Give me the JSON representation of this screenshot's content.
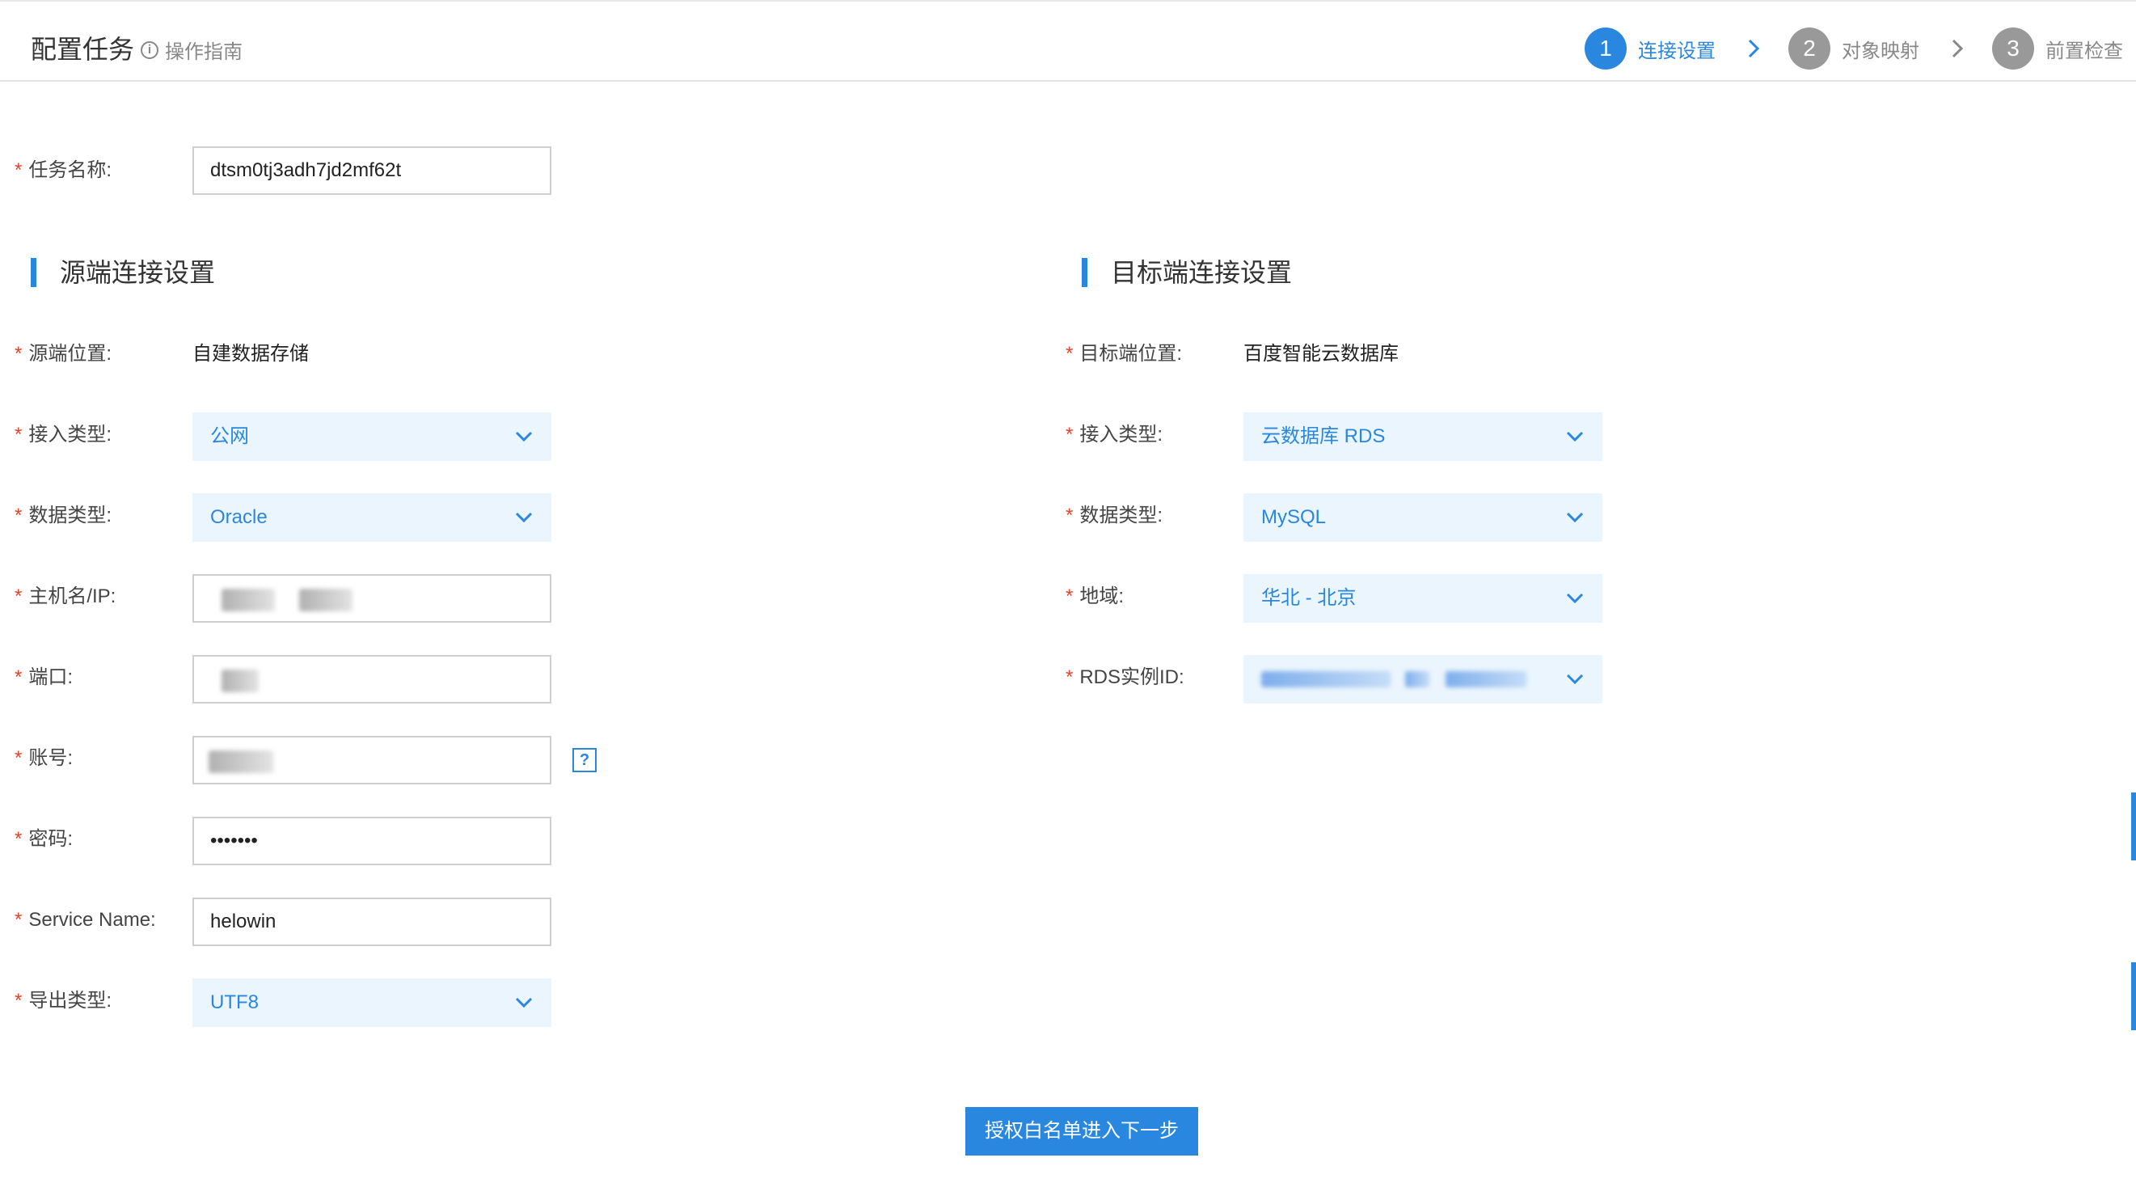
{
  "header": {
    "title": "配置任务",
    "guide_label": "操作指南",
    "steps": [
      {
        "number": "1",
        "label": "连接设置",
        "active": true
      },
      {
        "number": "2",
        "label": "对象映射",
        "active": false
      },
      {
        "number": "3",
        "label": "前置检查",
        "active": false
      }
    ]
  },
  "task": {
    "name_label": "任务名称:",
    "name_value": "dtsm0tj3adh7jd2mf62t"
  },
  "source": {
    "section_title": "源端连接设置",
    "location_label": "源端位置:",
    "location_value": "自建数据存储",
    "access_type_label": "接入类型:",
    "access_type_value": "公网",
    "db_type_label": "数据类型:",
    "db_type_value": "Oracle",
    "host_label": "主机名/IP:",
    "port_label": "端口:",
    "account_label": "账号:",
    "help_glyph": "?",
    "password_label": "密码:",
    "password_value": "•••••••",
    "service_name_label": "Service Name:",
    "service_name_value": "helowin",
    "export_type_label": "导出类型:",
    "export_type_value": "UTF8"
  },
  "target": {
    "section_title": "目标端连接设置",
    "location_label": "目标端位置:",
    "location_value": "百度智能云数据库",
    "access_type_label": "接入类型:",
    "access_type_value": "云数据库 RDS",
    "db_type_label": "数据类型:",
    "db_type_value": "MySQL",
    "region_label": "地域:",
    "region_value": "华北 - 北京",
    "rds_id_label": "RDS实例ID:"
  },
  "actions": {
    "next_label": "授权白名单进入下一步"
  },
  "icons": {
    "info": "info-circle-icon",
    "chevron": "chevron-down-icon",
    "step_arrow": "chevron-right-icon",
    "help": "question-mark-icon"
  },
  "colors": {
    "accent": "#2a87e0",
    "required": "#e8442d",
    "select_bg": "#ebf5fd",
    "inactive_step": "#999999"
  }
}
